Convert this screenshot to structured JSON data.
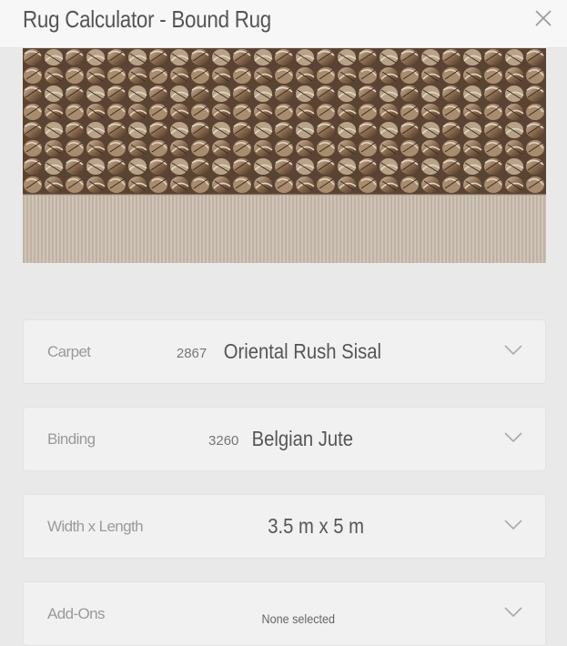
{
  "header": {
    "title": "Rug Calculator - Bound Rug"
  },
  "options": [
    {
      "label": "Carpet",
      "code": "2867",
      "value": "Oriental Rush Sisal"
    },
    {
      "label": "Binding",
      "code": "3260",
      "value": "Belgian Jute"
    },
    {
      "label": "Width x Length",
      "code": "",
      "value": "3.5 m x 5 m"
    },
    {
      "label": "Add-Ons",
      "code": "",
      "value": "None selected"
    }
  ],
  "colors": {
    "background": "#e9e9e9",
    "row": "#f1f1f1",
    "header": "#f7f7f7"
  }
}
